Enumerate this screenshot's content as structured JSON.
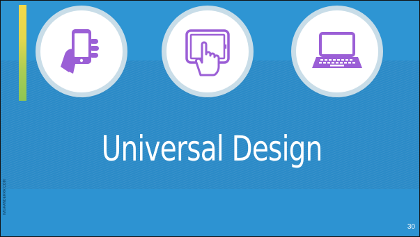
{
  "slide": {
    "title": "Universal Design",
    "page_number": "30",
    "credit": "IMGRANDERRR.COM"
  },
  "icons": [
    "smartphone-in-hand-icon",
    "tablet-touch-icon",
    "laptop-icon"
  ],
  "colors": {
    "background": "#2d93d2",
    "icon_purple": "#9b5fd6",
    "circle_ring": "#c9dde8",
    "accent_yellow": "#f6d94a",
    "accent_green": "#8ec653"
  }
}
